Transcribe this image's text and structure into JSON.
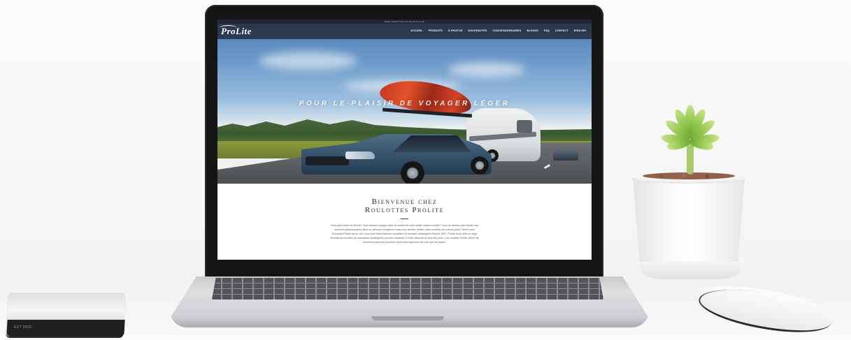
{
  "website": {
    "topbar_text": "Besoin d'aide? Nous sommes là pour vous",
    "logo": "ProLite",
    "nav": [
      "ACCUEIL",
      "PRODUITS",
      "À PROPOS",
      "NOUVEAUTÉS",
      "CONCESSIONNAIRES",
      "BLOGUE",
      "FAQ",
      "CONTACT",
      "ENGLISH"
    ],
    "hero_tagline": "POUR LE PLAISIR DE VOYAGER LÉGER",
    "welcome_title_line1": "Bienvenue chez",
    "welcome_title_line2": "Roulottes Prolite",
    "welcome_body": "Vous avez envie de liberté? Vous désirez voyager dans le confort de votre petite maison mobile? Vous ne désirez pas investir des sommes astronomiques dans un véhicule énergivore mais vous devriez utiliser votre véhicule de tous les jours? Alors notre Roulottes Prolite est ce qu'il vous faut! Manufacturier canadien de roulottes ultralégères depuis 1987, Prolite vous offre un large éventail de modèles de caravanes ultralégères pouvant s'adapter à votre véhicule de tous les jours. Les roulottes Prolite offrent de nombreux plans de plancher tous aussi ingénieux les uns que les autres."
  },
  "device_labels": {
    "hard_drive": "EXT HDD"
  }
}
